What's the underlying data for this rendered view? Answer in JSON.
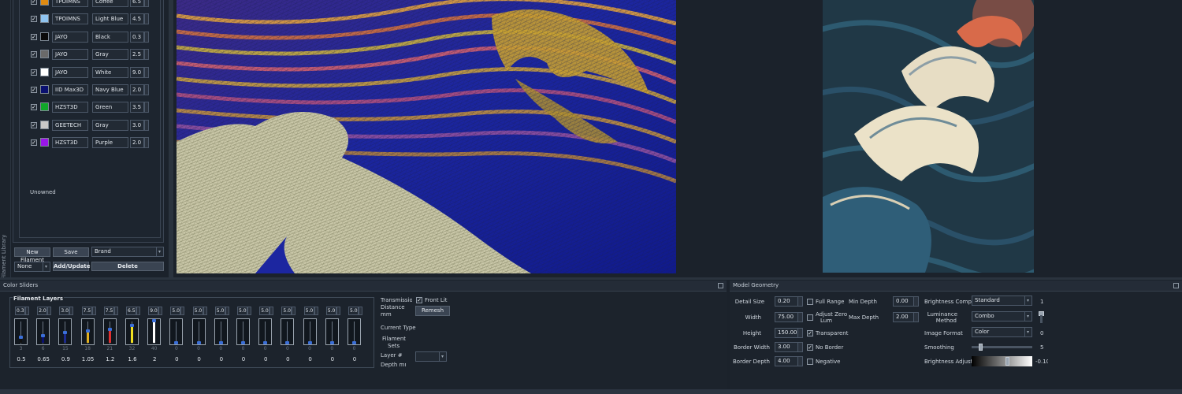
{
  "filament_library": {
    "tab_label": "Filament Library",
    "rows": [
      {
        "brand": "TPOIMNS",
        "color_name": "Coffee",
        "td": "6.5",
        "swatch": "#e08a10",
        "checked": true
      },
      {
        "brand": "TPOIMNS",
        "color_name": "Light Blue",
        "td": "4.5",
        "swatch": "#8fc4f0",
        "checked": true
      },
      {
        "brand": "JAYO",
        "color_name": "Black",
        "td": "0.3",
        "swatch": "#0a0a0a",
        "checked": true
      },
      {
        "brand": "JAYO",
        "color_name": "Gray",
        "td": "2.5",
        "swatch": "#6a6a6a",
        "checked": true
      },
      {
        "brand": "JAYO",
        "color_name": "White",
        "td": "9.0",
        "swatch": "#ffffff",
        "checked": true
      },
      {
        "brand": "IID Max3D",
        "color_name": "Navy Blue",
        "td": "2.0",
        "swatch": "#0a1070",
        "checked": true
      },
      {
        "brand": "HZST3D",
        "color_name": "Green",
        "td": "3.5",
        "swatch": "#11a629",
        "checked": true
      },
      {
        "brand": "GEETECH",
        "color_name": "Gray",
        "td": "3.0",
        "swatch": "#c8c8c8",
        "checked": true
      },
      {
        "brand": "HZST3D",
        "color_name": "Purple",
        "td": "2.0",
        "swatch": "#9a16e8",
        "checked": true
      }
    ],
    "unowned_label": "Unowned",
    "new_filament_label": "New Filament",
    "save_label": "Save",
    "sort_value": "Brand",
    "filter_value": "None",
    "add_update_label": "Add/Update",
    "delete_label": "Delete"
  },
  "color_sliders": {
    "title": "Color Sliders",
    "group_title": "Filament Layers",
    "layers": [
      {
        "td": "0.3",
        "num": "3",
        "value": "0.5",
        "color": "#111111",
        "level": 0.25
      },
      {
        "td": "2.0",
        "num": "6",
        "value": "0.65",
        "color": "#0a1070",
        "level": 0.33
      },
      {
        "td": "3.0",
        "num": "15",
        "value": "0.9",
        "color": "#1c2a8c",
        "level": 0.45
      },
      {
        "td": "7.5",
        "num": "18",
        "value": "1.05",
        "color": "#e0b020",
        "level": 0.52
      },
      {
        "td": "7.5",
        "num": "21",
        "value": "1.2",
        "color": "#e03030",
        "level": 0.6
      },
      {
        "td": "6.5",
        "num": "32",
        "value": "1.6",
        "color": "#f0e020",
        "level": 0.8
      },
      {
        "td": "9.0",
        "num": "40",
        "value": "2",
        "color": "#ffffff",
        "level": 1.0
      },
      {
        "td": "5.0",
        "num": "0",
        "value": "0",
        "color": "#3b6fd8",
        "level": 0.0
      },
      {
        "td": "5.0",
        "num": "0",
        "value": "0",
        "color": "#3b6fd8",
        "level": 0.0
      },
      {
        "td": "5.0",
        "num": "0",
        "value": "0",
        "color": "#3b6fd8",
        "level": 0.0
      },
      {
        "td": "5.0",
        "num": "0",
        "value": "0",
        "color": "#3b6fd8",
        "level": 0.0
      },
      {
        "td": "5.0",
        "num": "0",
        "value": "0",
        "color": "#3b6fd8",
        "level": 0.0
      },
      {
        "td": "5.0",
        "num": "0",
        "value": "0",
        "color": "#3b6fd8",
        "level": 0.0
      },
      {
        "td": "5.0",
        "num": "0",
        "value": "0",
        "color": "#3b6fd8",
        "level": 0.0
      },
      {
        "td": "5.0",
        "num": "0",
        "value": "0",
        "color": "#3b6fd8",
        "level": 0.0
      },
      {
        "td": "5.0",
        "num": "0",
        "value": "0",
        "color": "#3b6fd8",
        "level": 0.0
      }
    ],
    "transmission_label_1": "Transmission",
    "transmission_label_2": "Distance",
    "transmission_label_3": "mm",
    "front_lit_label": "Front Lit",
    "remesh_label": "Remesh",
    "current_type_label": "Current Type",
    "filament_sets_label_1": "Filament",
    "filament_sets_label_2": "Sets",
    "layer_label": "Layer #",
    "depth_label": "Depth mm"
  },
  "model_geometry": {
    "title": "Model Geometry",
    "detail_size_label": "Detail Size",
    "detail_size": "0.20",
    "width_label": "Width",
    "width": "75.00",
    "height_label": "Height",
    "height": "150.00",
    "border_width_label": "Border Width",
    "border_width": "3.00",
    "border_depth_label": "Border Depth",
    "border_depth": "4.00",
    "full_range_label": "Full Range",
    "adjust_zero_label_1": "Adjust Zero",
    "adjust_zero_label_2": "Lum",
    "transparent_label": "Transparent",
    "no_border_label": "No Border",
    "negative_label": "Negative",
    "min_depth_label": "Min Depth",
    "min_depth": "0.00",
    "max_depth_label": "Max Depth",
    "max_depth": "2.00",
    "brightness_comp_label": "Brightness Comp",
    "brightness_comp": "Standard",
    "brightness_comp_value": "1",
    "luminance_label_1": "Luminance",
    "luminance_label_2": "Method",
    "luminance_method": "Combo",
    "image_format_label": "Image Format",
    "image_format": "Color",
    "image_format_value": "0",
    "smoothing_label": "Smoothing",
    "smoothing_value": "5",
    "smoothing_level": 0.12,
    "brightness_adjust_label": "Brightness Adjust",
    "brightness_adjust_value": "-0.10",
    "brightness_adjust_level": 0.6
  }
}
